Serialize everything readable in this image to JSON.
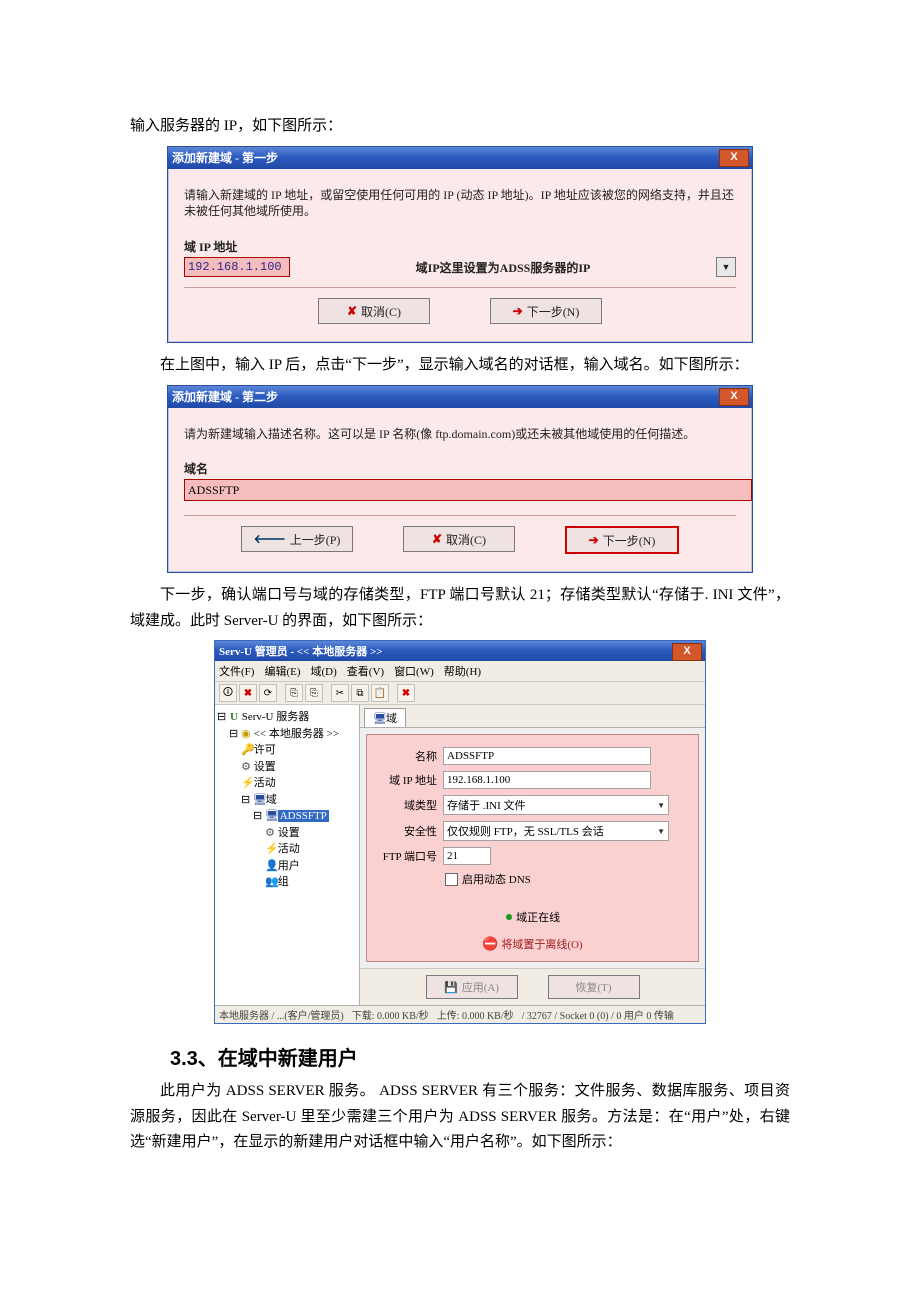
{
  "doc": {
    "p1": "输入服务器的 IP，如下图所示：",
    "p2": "在上图中，输入 IP 后，点击“下一步”，显示输入域名的对话框，输入域名。如下图所示：",
    "p3": "下一步，确认端口号与域的存储类型，FTP 端口号默认 21；存储类型默认“存储于. INI 文件”，域建成。此时 Server-U 的界面，如下图所示：",
    "section_title": "3.3、在域中新建用户",
    "p4": "此用户为 ADSS SERVER 服务。  ADSS SERVER 有三个服务：文件服务、数据库服务、项目资源服务，因此在 Server-U 里至少需建三个用户为 ADSS  SERVER 服务。方法是：在“用户”处，右键选“新建用户”，在显示的新建用户对话框中输入“用户名称”。如下图所示："
  },
  "dlg1": {
    "title": "添加新建域 - 第一步",
    "close": "X",
    "instr": "请输入新建域的 IP 地址，或留空使用任何可用的 IP (动态 IP 地址)。IP 地址应该被您的网络支持，并且还未被任何其他域所使用。",
    "label": "域 IP 地址",
    "ip_value": "192.168.1.100",
    "note": "域IP这里设置为ADSS服务器的IP",
    "cancel": "取消(C)",
    "next": "下一步(N)"
  },
  "dlg2": {
    "title": "添加新建域 - 第二步",
    "close": "X",
    "instr": "请为新建域输入描述名称。这可以是 IP 名称(像 ftp.domain.com)或还未被其他域使用的任何描述。",
    "label": "域名",
    "name_value": "ADSSFTP",
    "prev": "上一步(P)",
    "cancel": "取消(C)",
    "next": "下一步(N)"
  },
  "mw": {
    "title": "Serv-U 管理员 - << 本地服务器 >>",
    "menus": [
      "文件(F)",
      "编辑(E)",
      "域(D)",
      "查看(V)",
      "窗口(W)",
      "帮助(H)"
    ],
    "tree": {
      "root": "Serv-U 服务器",
      "local": "<< 本地服务器 >>",
      "license": "许可",
      "settings": "设置",
      "activity": "活动",
      "domains": "域",
      "domain_name": "ADSSFTP",
      "d_settings": "设置",
      "d_activity": "活动",
      "d_users": "用户",
      "d_groups": "组"
    },
    "tab": "域",
    "form": {
      "name_lbl": "名称",
      "name_val": "ADSSFTP",
      "ip_lbl": "域 IP 地址",
      "ip_val": "192.168.1.100",
      "type_lbl": "域类型",
      "type_val": "存储于 .INI 文件",
      "sec_lbl": "安全性",
      "sec_val": "仅仅规则 FTP，无 SSL/TLS 会话",
      "port_lbl": "FTP 端口号",
      "port_val": "21",
      "dyn_dns": "启用动态 DNS",
      "online": "域正在线",
      "offline": "将域置于离线(O)",
      "apply": "应用(A)",
      "restore": "恢复(T)"
    },
    "status": {
      "s1": "本地服务器 / ...(客户/管理员)",
      "s2": "下载: 0.000 KB/秒",
      "s3": "上传: 0.000 KB/秒",
      "s4": "/ 32767 / Socket   0 (0) / 0 用户  0 传输"
    }
  }
}
